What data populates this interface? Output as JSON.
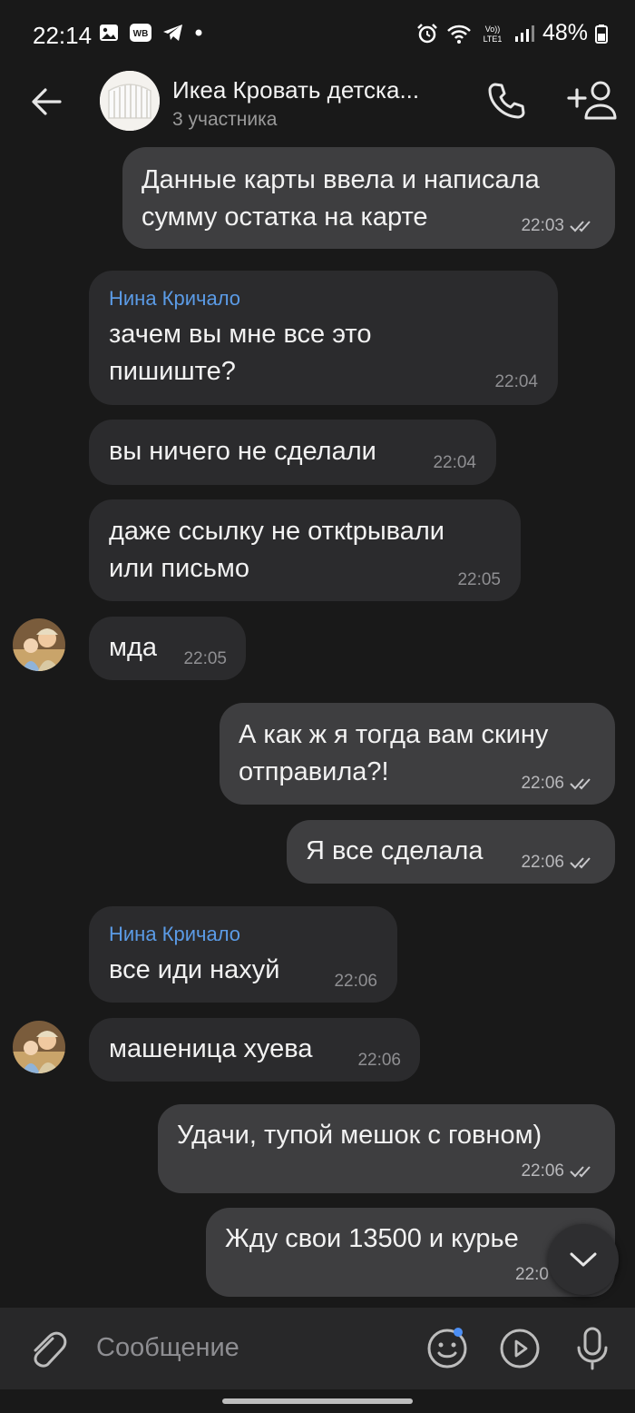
{
  "status_bar": {
    "time": "22:14",
    "battery": "48%"
  },
  "header": {
    "title": "Икеа Кровать детска...",
    "subtitle": "3 участника"
  },
  "messages": [
    {
      "text": "Данные карты ввела и написала\nсумму остатка на карте",
      "time": "22:03"
    },
    {
      "author": "Нина Кричало",
      "text": "зачем вы мне все это\nпишиште?",
      "time": "22:04"
    },
    {
      "text": "вы ничего не сделали",
      "time": "22:04"
    },
    {
      "text": "даже ссылку не откtрывали\nили письмо",
      "time": "22:05"
    },
    {
      "text": "мда",
      "time": "22:05"
    },
    {
      "text": "А как ж я тогда вам скину\nотправила?!",
      "time": "22:06"
    },
    {
      "text": "Я все сделала",
      "time": "22:06"
    },
    {
      "author": "Нина Кричало",
      "text": "все иди нахуй",
      "time": "22:06"
    },
    {
      "text": "машеница хуева",
      "time": "22:06"
    },
    {
      "text": "Удачи, тупой мешок с говном)",
      "time": "22:06"
    },
    {
      "text": "Жду свои 13500 и курье",
      "time": "22:0"
    }
  ],
  "composer": {
    "placeholder": "Сообщение"
  },
  "icons": {
    "back": "arrow-left-icon",
    "call": "phone-icon",
    "add_member": "add-user-icon",
    "attach": "paperclip-icon",
    "sticker": "smile-icon",
    "video": "video-message-icon",
    "mic": "microphone-icon",
    "scroll": "chevron-down-icon"
  },
  "colors": {
    "background": "#191919",
    "outgoing": "#3e3e40",
    "incoming": "#2b2b2d",
    "author": "#5b9be6",
    "unread_dot": "#4c8ff5"
  }
}
